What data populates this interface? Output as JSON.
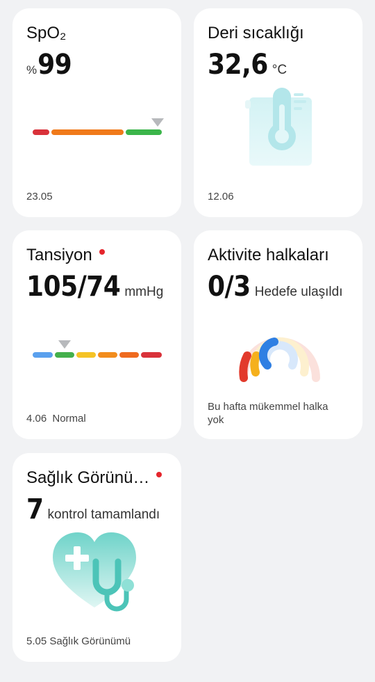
{
  "spo2": {
    "title": "SpO₂",
    "prefix": "%",
    "value": "99",
    "date": "23.05",
    "colors": {
      "low": "#d9323a",
      "mid": "#f07a1a",
      "high": "#3bb54a"
    }
  },
  "skin_temp": {
    "title": "Deri sıcaklığı",
    "value": "32,6",
    "unit": "°C",
    "date": "12.06",
    "icon": "thermometer-icon"
  },
  "blood_pressure": {
    "title": "Tansiyon",
    "value": "105/74",
    "unit": "mmHg",
    "date": "4.06",
    "status": "Normal",
    "colors": [
      "#5aa0ee",
      "#44b04c",
      "#f5c326",
      "#f28c1c",
      "#ef6a1f",
      "#d9323a"
    ]
  },
  "activity": {
    "title": "Aktivite halkaları",
    "value": "0/3",
    "unit": "Hedefe ulaşıldı",
    "footer": "Bu hafta mükemmel halka yok",
    "rings": [
      {
        "name": "outer",
        "color": "#e23a2c"
      },
      {
        "name": "middle",
        "color": "#f5b01c"
      },
      {
        "name": "inner",
        "color": "#2f7fe3"
      }
    ]
  },
  "health_view": {
    "title": "Sağlık Görünü…",
    "value": "7",
    "unit": "kontrol tamamlandı",
    "date": "5.05",
    "footer_label": "Sağlık Görünümü",
    "icon": "heart-stethoscope-icon"
  }
}
